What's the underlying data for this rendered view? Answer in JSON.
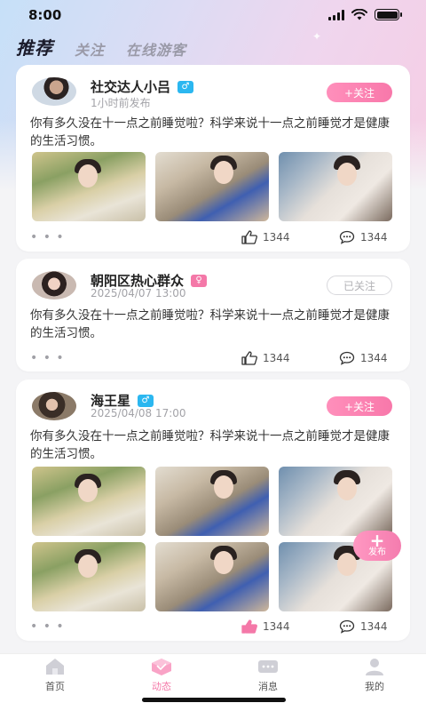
{
  "status_bar": {
    "time": "8:00"
  },
  "top_tabs": [
    {
      "label": "推荐",
      "active": true
    },
    {
      "label": "关注",
      "active": false
    },
    {
      "label": "在线游客",
      "active": false
    }
  ],
  "posts": [
    {
      "username": "社交达人小吕",
      "gender": "male",
      "gender_icon": "male-symbol-icon",
      "time": "1小时前发布",
      "follow_label": "+关注",
      "followed": false,
      "content": "你有多久没在十一点之前睡觉啦？科学来说十一点之前睡觉才是健康的生活习惯。",
      "photo_count": 3,
      "likes": "1344",
      "comments": "1344",
      "liked": false
    },
    {
      "username": "朝阳区热心群众",
      "gender": "female",
      "gender_icon": "female-symbol-icon",
      "time": "2025/04/07  13:00",
      "follow_label": "已关注",
      "followed": true,
      "content": "你有多久没在十一点之前睡觉啦？科学来说十一点之前睡觉才是健康的生活习惯。",
      "photo_count": 0,
      "likes": "1344",
      "comments": "1344",
      "liked": false
    },
    {
      "username": "海王星",
      "gender": "male",
      "gender_icon": "male-symbol-icon",
      "time": "2025/04/08   17:00",
      "follow_label": "+关注",
      "followed": false,
      "content": "你有多久没在十一点之前睡觉啦？科学来说十一点之前睡觉才是健康的生活习惯。",
      "photo_count": 6,
      "likes": "1344",
      "comments": "1344",
      "liked": true
    }
  ],
  "fab": {
    "label": "发布"
  },
  "bottom_tabs": [
    {
      "label": "首页",
      "icon": "home-icon",
      "active": false
    },
    {
      "label": "动态",
      "icon": "feed-cube-icon",
      "active": true
    },
    {
      "label": "消息",
      "icon": "message-icon",
      "active": false
    },
    {
      "label": "我的",
      "icon": "profile-icon",
      "active": false
    }
  ],
  "colors": {
    "accent": "#f478a8",
    "male": "#2bb7f0",
    "female": "#f478a8"
  }
}
